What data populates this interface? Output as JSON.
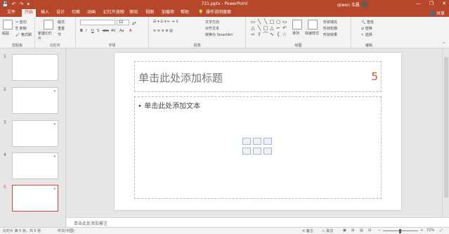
{
  "titlebar": {
    "title": "721.pptx - PowerPoint",
    "user": "qiwen 韦晨",
    "qat": [
      "save-icon",
      "undo-icon",
      "redo-icon",
      "customize-icon"
    ],
    "window_buttons": [
      "—",
      "❐",
      "✕"
    ]
  },
  "tabs": {
    "items": [
      "文件",
      "开始",
      "插入",
      "设计",
      "切换",
      "动画",
      "幻灯片放映",
      "审阅",
      "视图",
      "加载项",
      "帮助"
    ],
    "active": "开始",
    "tell_me": "操作说明搜索",
    "share": "共享"
  },
  "ribbon": {
    "clipboard": {
      "label": "剪贴板",
      "paste": "粘贴",
      "cut": "剪切",
      "copy": "复制",
      "format_painter": "格式刷"
    },
    "slides": {
      "label": "幻灯片",
      "new_slide": "新建幻灯片",
      "layout": "版式",
      "reset": "重置",
      "section": "节"
    },
    "font": {
      "label": "字体",
      "font_name": "",
      "font_size": "12",
      "buttons": [
        "B",
        "I",
        "U",
        "S",
        "abc",
        "AV",
        "Aa",
        "A"
      ]
    },
    "paragraph": {
      "label": "段落",
      "text_direction": "文字方向",
      "align_text": "对齐文本",
      "smartart": "转换为 SmartArt"
    },
    "drawing": {
      "label": "绘图",
      "arrange": "排列",
      "quick_styles": "快速样式",
      "shape_fill": "形状填充",
      "shape_outline": "形状轮廓",
      "shape_effects": "形状效果"
    },
    "editing": {
      "label": "编辑",
      "find": "查找",
      "replace": "替换",
      "select": "选择"
    }
  },
  "thumbnails": {
    "items": [
      {
        "num": "1",
        "star": ""
      },
      {
        "num": "2",
        "star": "★"
      },
      {
        "num": "3",
        "star": "★"
      },
      {
        "num": "4",
        "star": "★"
      },
      {
        "num": "5",
        "star": "★"
      }
    ],
    "selected": "5"
  },
  "slide": {
    "title_placeholder": "单击此处添加标题",
    "title_number": "5",
    "content_placeholder": "• 单击此处添加文本",
    "content_icons": [
      "table-icon",
      "chart-icon",
      "smartart-icon",
      "picture-icon",
      "online-picture-icon",
      "video-icon"
    ]
  },
  "notes": {
    "placeholder": "单击此处添加备注"
  },
  "status": {
    "slide_info": "幻灯片 第 5 张，共 5 张",
    "language": "中文(中国)",
    "notes_btn": "备注",
    "comments_btn": "批注",
    "zoom": "72%"
  },
  "colors": {
    "accent": "#b7472a",
    "selection": "#d24726"
  }
}
